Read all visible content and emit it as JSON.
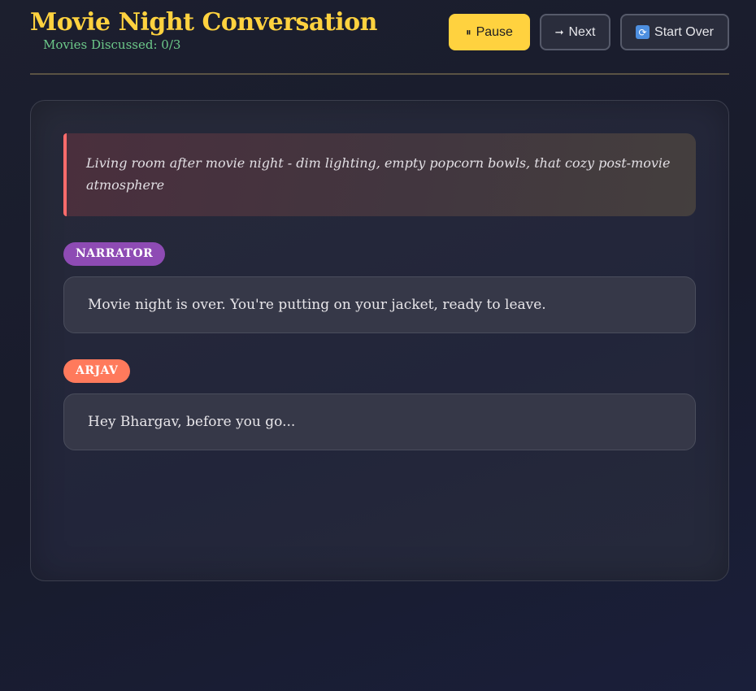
{
  "header": {
    "title": "Movie Night Conversation",
    "counter": "Movies Discussed: 0/3"
  },
  "controls": {
    "pause": {
      "label": "Pause",
      "icon": "pause-icon",
      "glyph": "⏸"
    },
    "next": {
      "label": "Next",
      "icon": "arrow-right-icon",
      "glyph": "➞"
    },
    "start_over": {
      "label": "Start Over",
      "icon": "restart-icon",
      "glyph": "🔁"
    }
  },
  "scene": {
    "description": "Living room after movie night - dim lighting, empty popcorn bowls, that cozy post-movie atmosphere"
  },
  "dialogue": [
    {
      "speaker": "NARRATOR",
      "text": "Movie night is over. You're putting on your jacket, ready to leave."
    },
    {
      "speaker": "ARJAV",
      "text": "Hey Bhargav, before you go..."
    }
  ],
  "colors": {
    "title": "#ffd23f",
    "counter": "#6dc98a",
    "narrator_badge": "#8e4bb4",
    "arjav_badge": "#ff7a5c",
    "scene_accent": "#ff6b6b",
    "primary_button": "#ffd23f"
  }
}
